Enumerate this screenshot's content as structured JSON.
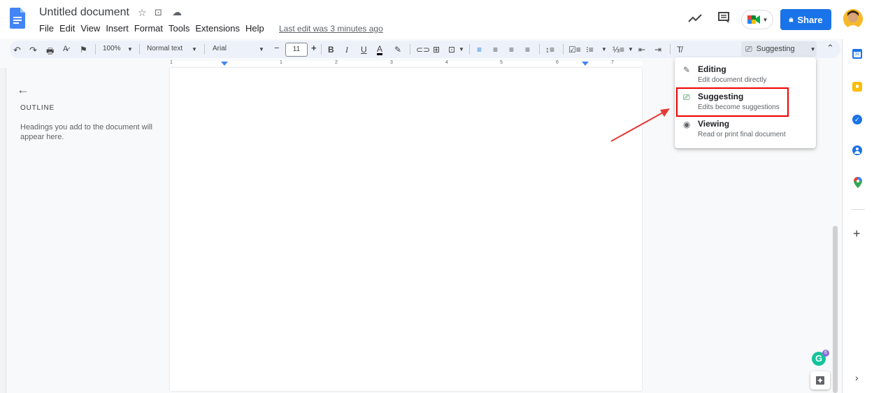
{
  "header": {
    "title": "Untitled document",
    "menu": [
      "File",
      "Edit",
      "View",
      "Insert",
      "Format",
      "Tools",
      "Extensions",
      "Help"
    ],
    "last_edit": "Last edit was 3 minutes ago",
    "share_label": "Share"
  },
  "toolbar": {
    "zoom": "100%",
    "style": "Normal text",
    "font": "Arial",
    "font_size": "11",
    "mode_label": "Suggesting"
  },
  "ruler_numbers": [
    "1",
    "1",
    "2",
    "3",
    "4",
    "5",
    "6",
    "7"
  ],
  "outline": {
    "title": "OUTLINE",
    "hint": "Headings you add to the document will appear here."
  },
  "mode_menu": {
    "items": [
      {
        "label": "Editing",
        "sub": "Edit document directly",
        "icon": "pencil-icon"
      },
      {
        "label": "Suggesting",
        "sub": "Edits become suggestions",
        "icon": "suggest-icon"
      },
      {
        "label": "Viewing",
        "sub": "Read or print final document",
        "icon": "eye-icon"
      }
    ]
  },
  "grammarly_count": "6",
  "colors": {
    "accent": "#1a73e8",
    "highlight": "#e00000",
    "annotation_arrow": "#e53935"
  }
}
